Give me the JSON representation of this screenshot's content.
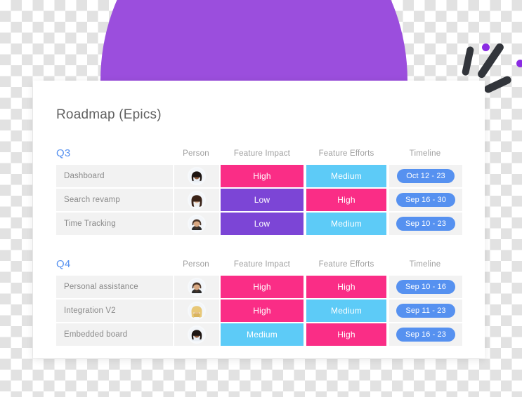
{
  "card": {
    "title": "Roadmap (Epics)"
  },
  "colors": {
    "accent_blue": "#5691F0",
    "high": "#FA2D86",
    "medium": "#5DCBF7",
    "low": "#7C45D6",
    "dome_purple": "#9B4EDD",
    "deco_dot": "#8A2BE2",
    "deco_slash": "#32353B",
    "row_background": "#F2F2F2"
  },
  "columns": {
    "name": "",
    "person": "Person",
    "impact": "Feature Impact",
    "efforts": "Feature Efforts",
    "timeline": "Timeline"
  },
  "quarters": [
    {
      "label": "Q3",
      "rows": [
        {
          "name": "Dashboard",
          "avatar": "avatar-woman-dark-hair",
          "impact": "High",
          "impact_level": "high",
          "effort": "Medium",
          "effort_level": "medium",
          "timeline": "Oct 12 - 23"
        },
        {
          "name": "Search revamp",
          "avatar": "avatar-woman-long-hair",
          "impact": "Low",
          "impact_level": "low",
          "effort": "High",
          "effort_level": "high",
          "timeline": "Sep 16 - 30"
        },
        {
          "name": "Time Tracking",
          "avatar": "avatar-man-beard",
          "impact": "Low",
          "impact_level": "low",
          "effort": "Medium",
          "effort_level": "medium",
          "timeline": "Sep 10 - 23"
        }
      ]
    },
    {
      "label": "Q4",
      "rows": [
        {
          "name": "Personal assistance",
          "avatar": "avatar-man-beard",
          "impact": "High",
          "impact_level": "high",
          "effort": "High",
          "effort_level": "high",
          "timeline": "Sep 10 - 16"
        },
        {
          "name": "Integration V2",
          "avatar": "avatar-woman-blonde",
          "impact": "High",
          "impact_level": "high",
          "effort": "Medium",
          "effort_level": "medium",
          "timeline": "Sep 11 - 23"
        },
        {
          "name": "Embedded board",
          "avatar": "avatar-woman-dark-hair",
          "impact": "Medium",
          "impact_level": "medium",
          "effort": "High",
          "effort_level": "high",
          "timeline": "Sep 16 - 23"
        }
      ]
    }
  ]
}
